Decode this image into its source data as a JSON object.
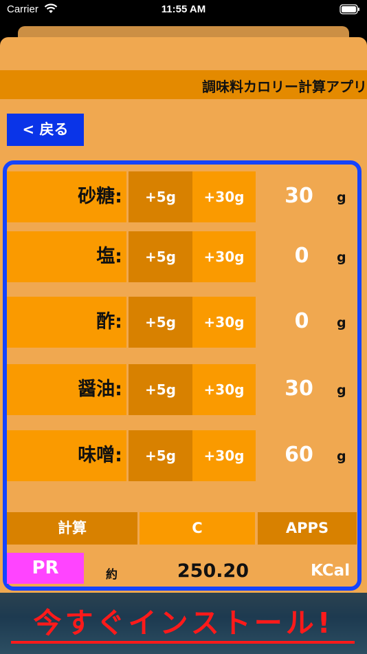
{
  "status_bar": {
    "carrier": "Carrier",
    "time": "11:55 AM"
  },
  "header": {
    "title": "調味料カロリー計算アプリ"
  },
  "nav": {
    "back_label": "< 戻る"
  },
  "ingredients": [
    {
      "label": "砂糖:",
      "btn_small": "+5g",
      "btn_large": "+30g",
      "value": "30",
      "unit": "g"
    },
    {
      "label": "塩:",
      "btn_small": "+5g",
      "btn_large": "+30g",
      "value": "0",
      "unit": "g"
    },
    {
      "label": "酢:",
      "btn_small": "+5g",
      "btn_large": "+30g",
      "value": "0",
      "unit": "g"
    },
    {
      "label": "醤油:",
      "btn_small": "+5g",
      "btn_large": "+30g",
      "value": "30",
      "unit": "g"
    },
    {
      "label": "味噌:",
      "btn_small": "+5g",
      "btn_large": "+30g",
      "value": "60",
      "unit": "g"
    }
  ],
  "actions": {
    "calculate": "計算",
    "clear": "C",
    "apps": "APPS"
  },
  "result": {
    "pr_label": "PR",
    "approx_label": "約",
    "value": "250.20",
    "unit": "KCal"
  },
  "ad": {
    "text": "今すぐインストール!"
  },
  "colors": {
    "accent_orange": "#fa9a00",
    "dark_orange": "#d88100",
    "panel_bg": "#f0a850",
    "frame_blue": "#1544ff",
    "back_blue": "#0a34e8",
    "pr_magenta": "#ff44ff",
    "ad_red": "#ff1a1a"
  }
}
